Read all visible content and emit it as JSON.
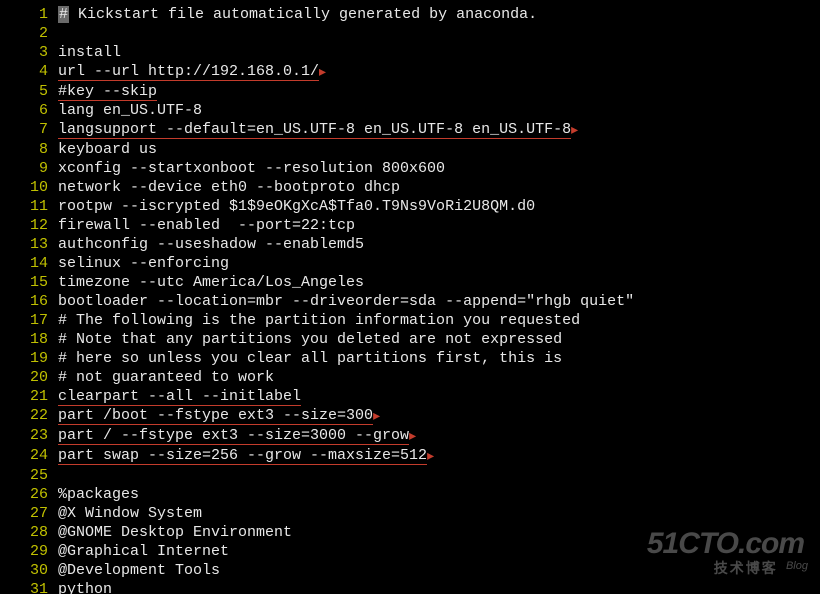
{
  "lines": [
    {
      "n": 1,
      "segs": [
        {
          "t": "#",
          "cls": "hl-block"
        },
        {
          "t": " Kickstart file automatically generated by anaconda."
        }
      ]
    },
    {
      "n": 2,
      "segs": [
        {
          "t": ""
        }
      ]
    },
    {
      "n": 3,
      "segs": [
        {
          "t": "install"
        }
      ]
    },
    {
      "n": 4,
      "segs": [
        {
          "t": "url --url http://192.168.0.1/",
          "cls": "underline-red"
        },
        {
          "t": "▸",
          "cls": "arrow"
        }
      ]
    },
    {
      "n": 5,
      "segs": [
        {
          "t": "#key --skip",
          "cls": "underline-red"
        }
      ]
    },
    {
      "n": 6,
      "segs": [
        {
          "t": "lang en_US.UTF-8"
        }
      ]
    },
    {
      "n": 7,
      "segs": [
        {
          "t": "langsupport --default=en_US.UTF-8 en_US.UTF-8 en_US.UTF-8",
          "cls": "underline-red"
        },
        {
          "t": "▸",
          "cls": "arrow"
        }
      ]
    },
    {
      "n": 8,
      "segs": [
        {
          "t": "keyboard us"
        }
      ]
    },
    {
      "n": 9,
      "segs": [
        {
          "t": "xconfig --startxonboot --resolution 800x600"
        }
      ]
    },
    {
      "n": 10,
      "segs": [
        {
          "t": "network --device eth0 --bootproto dhcp"
        }
      ]
    },
    {
      "n": 11,
      "segs": [
        {
          "t": "rootpw --iscrypted $1$9eOKgXcA$Tfa0.T9Ns9VoRi2U8QM.d0"
        }
      ]
    },
    {
      "n": 12,
      "segs": [
        {
          "t": "firewall --enabled  --port=22:tcp"
        }
      ]
    },
    {
      "n": 13,
      "segs": [
        {
          "t": "authconfig --useshadow --enablemd5"
        }
      ]
    },
    {
      "n": 14,
      "segs": [
        {
          "t": "selinux --enforcing"
        }
      ]
    },
    {
      "n": 15,
      "segs": [
        {
          "t": "timezone --utc America/Los_Angeles"
        }
      ]
    },
    {
      "n": 16,
      "segs": [
        {
          "t": "bootloader --location=mbr --driveorder=sda --append=\"rhgb quiet\""
        }
      ]
    },
    {
      "n": 17,
      "segs": [
        {
          "t": "# The following is the partition information you requested"
        }
      ]
    },
    {
      "n": 18,
      "segs": [
        {
          "t": "# Note that any partitions you deleted are not expressed"
        }
      ]
    },
    {
      "n": 19,
      "segs": [
        {
          "t": "# here so unless you clear all partitions first, this is"
        }
      ]
    },
    {
      "n": 20,
      "segs": [
        {
          "t": "# not guaranteed to work"
        }
      ]
    },
    {
      "n": 21,
      "segs": [
        {
          "t": "clearpart --all --initlabel",
          "cls": "underline-red"
        }
      ]
    },
    {
      "n": 22,
      "segs": [
        {
          "t": "part /boot --fstype ext3 --size=300",
          "cls": "underline-red"
        },
        {
          "t": "▸",
          "cls": "arrow"
        }
      ]
    },
    {
      "n": 23,
      "segs": [
        {
          "t": "part / --fstype ext3 --size=3000 --grow",
          "cls": "underline-red"
        },
        {
          "t": "▸",
          "cls": "arrow"
        }
      ]
    },
    {
      "n": 24,
      "segs": [
        {
          "t": "part swap --size=256 --grow --maxsize=512",
          "cls": "underline-red"
        },
        {
          "t": "▸",
          "cls": "arrow"
        }
      ]
    },
    {
      "n": 25,
      "segs": [
        {
          "t": ""
        }
      ]
    },
    {
      "n": 26,
      "segs": [
        {
          "t": "%packages"
        }
      ]
    },
    {
      "n": 27,
      "segs": [
        {
          "t": "@X Window System"
        }
      ]
    },
    {
      "n": 28,
      "segs": [
        {
          "t": "@GNOME Desktop Environment"
        }
      ]
    },
    {
      "n": 29,
      "segs": [
        {
          "t": "@Graphical Internet"
        }
      ]
    },
    {
      "n": 30,
      "segs": [
        {
          "t": "@Development Tools"
        }
      ]
    },
    {
      "n": 31,
      "segs": [
        {
          "t": "python"
        }
      ]
    }
  ],
  "watermark": {
    "big": "51CTO.com",
    "small": "技术博客",
    "blog": "Blog"
  }
}
